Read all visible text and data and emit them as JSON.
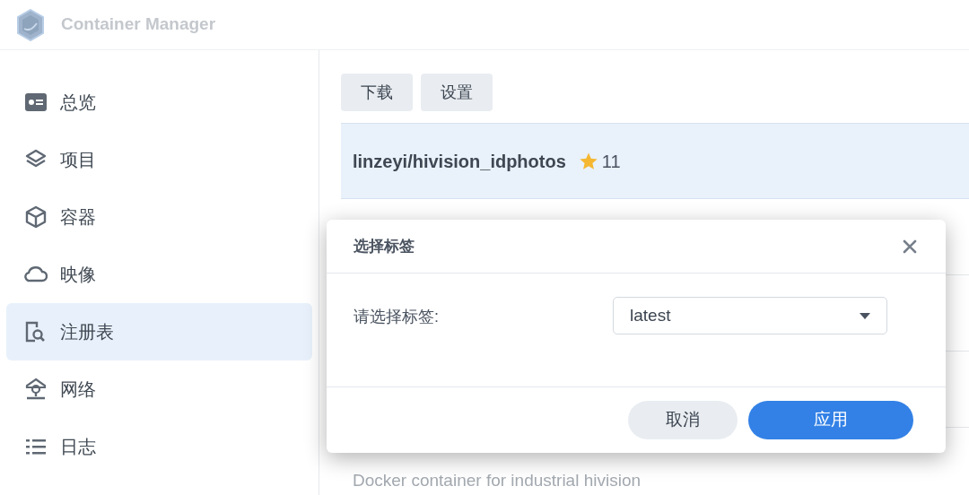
{
  "app": {
    "title": "Container Manager"
  },
  "sidebar": {
    "items": [
      {
        "label": "总览",
        "kind": "overview",
        "selected": false
      },
      {
        "label": "项目",
        "kind": "layers",
        "selected": false
      },
      {
        "label": "容器",
        "kind": "cube",
        "selected": false
      },
      {
        "label": "映像",
        "kind": "cloud",
        "selected": false
      },
      {
        "label": "注册表",
        "kind": "registry",
        "selected": true
      },
      {
        "label": "网络",
        "kind": "network",
        "selected": false
      },
      {
        "label": "日志",
        "kind": "list",
        "selected": false
      }
    ]
  },
  "toolbar": {
    "buttons": [
      "下载",
      "设置"
    ]
  },
  "repositories": [
    {
      "name": "linzeyi/hivision_idphotos",
      "stars": "11",
      "selected": true
    },
    {
      "description": "Docker container for industrial hivision",
      "selected": false
    }
  ],
  "dialog": {
    "title": "选择标签",
    "field_label": "请选择标签:",
    "select_value": "latest",
    "buttons": [
      {
        "label": "取消",
        "kind": "secondary"
      },
      {
        "label": "应用",
        "kind": "primary"
      }
    ]
  }
}
